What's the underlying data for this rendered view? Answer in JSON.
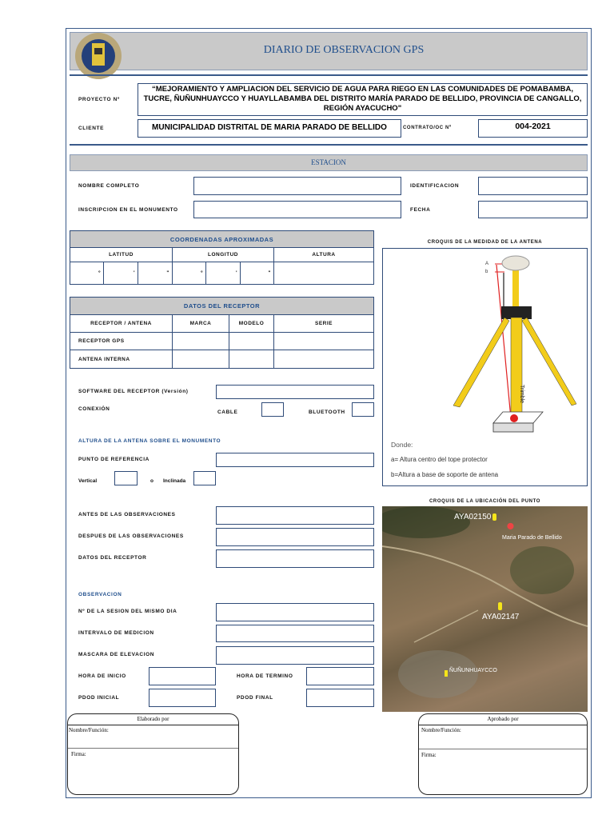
{
  "header": {
    "title": "DIARIO DE OBSERVACION GPS",
    "logo_text": "INNOVACIÓN TECNOLÓGICA PERÚ SAC"
  },
  "proyecto": {
    "label": "PROYECTO Nº",
    "value": "“MEJORAMIENTO Y AMPLIACION DEL SERVICIO DE AGUA PARA RIEGO EN LAS COMUNIDADES DE POMABAMBA, TUCRE, ÑUÑUNHUAYCCO Y HUAYLLABAMBA DEL DISTRITO MARÍA PARADO DE BELLIDO, PROVINCIA DE CANGALLO, REGIÓN AYACUCHO\""
  },
  "cliente": {
    "label": "CLIENTE",
    "value": "MUNICIPALIDAD DISTRITAL DE MARIA PARADO DE BELLIDO",
    "contrato_label": "CONTRATO/OC Nº",
    "contrato_value": "004-2021"
  },
  "estacion": {
    "title": "ESTACION",
    "nombre": "NOMBRE COMPLETO",
    "identificacion": "IDENTIFICACION",
    "inscripcion": "INSCRIPCION EN EL MONUMENTO",
    "fecha": "FECHA"
  },
  "coordenadas": {
    "title": "COORDENADAS APROXIMADAS",
    "latitud": "LATITUD",
    "longitud": "LONGITUD",
    "altura": "ALTURA",
    "deg": "º",
    "min": "'",
    "sec": "\""
  },
  "receptor": {
    "title": "DATOS DEL RECEPTOR",
    "cols": [
      "RECEPTOR / ANTENA",
      "MARCA",
      "MODELO",
      "SERIE"
    ],
    "rows": [
      "RECEPTOR GPS",
      "ANTENA INTERNA"
    ]
  },
  "software": {
    "label": "SOFTWARE DEL RECEPTOR (Versión)",
    "conexion": "CONEXIÓN",
    "cable": "CABLE",
    "bluetooth": "BLUETOOTH"
  },
  "altura": {
    "title": "ALTURA DE LA ANTENA SOBRE EL MONUMENTO",
    "punto": "PUNTO DE REFERENCIA",
    "vertical": "Vertical",
    "o": "o",
    "inclinada": "Inclinada",
    "antes": "ANTES DE LAS OBSERVACIONES",
    "despues": "DESPUES DE LAS OBSERVACIONES",
    "datos": "DATOS DEL RECEPTOR"
  },
  "observacion": {
    "title": "OBSERVACION",
    "sesion": "Nº DE LA SESION DEL MISMO DIA",
    "intervalo": "INTERVALO DE MEDICION",
    "mascara": "MASCARA DE ELEVACION",
    "hora_inicio": "HORA DE INICIO",
    "hora_termino": "HORA DE TERMINO",
    "pdop_inicial": "PDOD INICIAL",
    "pdop_final": "PDOD FINAL"
  },
  "croquis_antena": {
    "title": "CROQUIS DE LA MEDIDAD DE LA ANTENA",
    "a": "A",
    "b": "b",
    "brand": "Trimble",
    "donde": "Donde:",
    "line_a": "a= Altura centro del tope protector",
    "line_b": "b=Altura a base de soporte de antena"
  },
  "croquis_ubicacion": {
    "title": "CROQUIS DE LA UBICACIÓN DEL PUNTO",
    "points": [
      "AYA02150",
      "AYA02147",
      "ÑUÑUNHUAYCCO"
    ],
    "place": "Maria Parado de Bellido"
  },
  "firmas": {
    "elaborado": "Elaborado por",
    "aprobado": "Aprobado por",
    "nombre": "Nombre/Función:",
    "firma": "Firma:"
  }
}
